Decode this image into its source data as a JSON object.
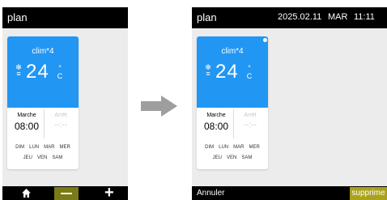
{
  "left_screen": {
    "title": "plan",
    "card": {
      "name": "clim*4",
      "temperature": "24",
      "unit": "°C",
      "start_label": "Marche",
      "start_time": "08:00",
      "stop_label": "Arrêt",
      "stop_time": "--:--",
      "days_row1": [
        "DIM",
        "LUN",
        "MAR",
        "MER"
      ],
      "days_row2": [
        "JEU",
        "VEN",
        "SAM"
      ]
    },
    "bottom": {
      "home_icon": "home-icon",
      "minus_icon": "minus-icon",
      "plus_icon": "plus-icon"
    }
  },
  "right_screen": {
    "title": "plan",
    "date": "2025.02.11",
    "day": "MAR",
    "time": "11:11",
    "card": {
      "name": "clim*4",
      "temperature": "24",
      "unit": "°C",
      "start_label": "Marche",
      "start_time": "08:00",
      "stop_label": "Arrêt",
      "stop_time": "--:--",
      "days_row1": [
        "DIM",
        "LUN",
        "MAR",
        "MER"
      ],
      "days_row2": [
        "JEU",
        "VEN",
        "SAM"
      ]
    },
    "bottom": {
      "cancel_label": "Annuler",
      "delete_label": "supprime"
    }
  },
  "colors": {
    "card_header": "#2196f3",
    "topbar": "#000000",
    "accent_button": "#aaa21c",
    "background": "#ececec"
  }
}
